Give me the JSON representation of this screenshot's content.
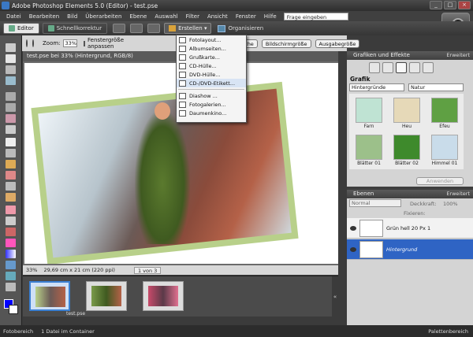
{
  "app": {
    "title": "Adobe Photoshop Elements 5.0 (Editor) - test.pse"
  },
  "menubar": {
    "items": [
      "Datei",
      "Bearbeiten",
      "Bild",
      "Überarbeiten",
      "Ebene",
      "Auswahl",
      "Filter",
      "Ansicht",
      "Fenster",
      "Hilfe"
    ],
    "help_placeholder": "Frage eingeben"
  },
  "modebar": {
    "editor": "Editor",
    "quickfix": "Schnellkorrektur",
    "create": "Erstellen",
    "organize": "Organisieren"
  },
  "options": {
    "zoom_label": "Zoom:",
    "zoom_value": "33%",
    "fit_label": "Fenstergröße anpassen",
    "btn_actual": "Tatsächliche Pixel",
    "btn_screen": "Bildschirmgröße",
    "btn_print": "Ausgabegröße"
  },
  "create_menu": {
    "items": [
      "Fotolayout...",
      "Albumseiten...",
      "Grußkarte...",
      "CD-Hülle...",
      "DVD-Hülle...",
      "CD-/DVD-Etikett...",
      "Diashow ...",
      "Fotogalerien...",
      "Daumenkino..."
    ]
  },
  "document": {
    "title": "test.pse bei 33% (Hintergrund, RGB/8)",
    "zoom": "33%",
    "size": "29,69 cm x 21 cm (220 ppi)",
    "page": "1 von 3"
  },
  "photobin": {
    "label": "test.pse"
  },
  "effects": {
    "header": "Grafiken und Effekte",
    "more": "Erweitert",
    "section": "Grafik",
    "select1": "Hintergründe",
    "select2": "Natur",
    "items": [
      {
        "label": "Farn",
        "color": "#bfe3d3"
      },
      {
        "label": "Heu",
        "color": "#e6d9b8"
      },
      {
        "label": "Efeu",
        "color": "#5fa043"
      },
      {
        "label": "Blätter 01",
        "color": "#9cc08a"
      },
      {
        "label": "Blätter 02",
        "color": "#3e8a2c"
      },
      {
        "label": "Himmel 01",
        "color": "#c9dcea"
      }
    ],
    "apply": "Anwenden"
  },
  "layers": {
    "header": "Ebenen",
    "more": "Erweitert",
    "blend": "Normal",
    "opacity_label": "Deckkraft:",
    "opacity": "100%",
    "lock_label": "Fixieren:",
    "rows": [
      {
        "name": "Grün hell 20 Px 1"
      },
      {
        "name": "Hintergrund"
      }
    ]
  },
  "status": {
    "bin": "Fotobereich",
    "info": "1 Datei im Container",
    "palettes": "Palettenbereich"
  }
}
